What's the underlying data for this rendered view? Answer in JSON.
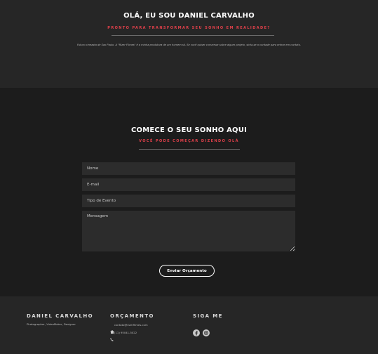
{
  "intro": {
    "title": "OLÁ, EU SOU DANIEL CARVALHO",
    "subtitle": "PRONTO PARA TRANSFORMAR SEU SONHO EM REALIDADE?",
    "text": "Futuro cineasta de Sao Paulo. A \"Rizer Filmes\" é a minha produtora de um homem só. Se você quiser conversar sobre algum projeto, sinta-se a vontade para entrar em contato."
  },
  "contact": {
    "title": "COMECE O SEU SONHO AQUI",
    "subtitle": "VOCÊ PODE COMEÇAR DIZENDO OLÁ",
    "fields": {
      "name": "Nome",
      "email": "E-mail",
      "event_type": "Tipo de Evento",
      "message": "Mensagem"
    },
    "submit_label": "Enviar Orçamento"
  },
  "footer": {
    "about": {
      "title": "DANIEL CARVALHO",
      "text": "Photographer, VideoMaker, Designer"
    },
    "quote": {
      "title": "ORÇAMENTO",
      "email": "contato@rizerfilmes.com",
      "phone": "(11) 95041-5022"
    },
    "social": {
      "title": "SIGA ME",
      "icons": [
        "facebook-icon",
        "instagram-icon"
      ]
    }
  },
  "colors": {
    "accent": "#e0404a",
    "intro_bg": "#262626",
    "form_bg": "#1c1c1c",
    "field_bg": "#2c2c2c"
  }
}
